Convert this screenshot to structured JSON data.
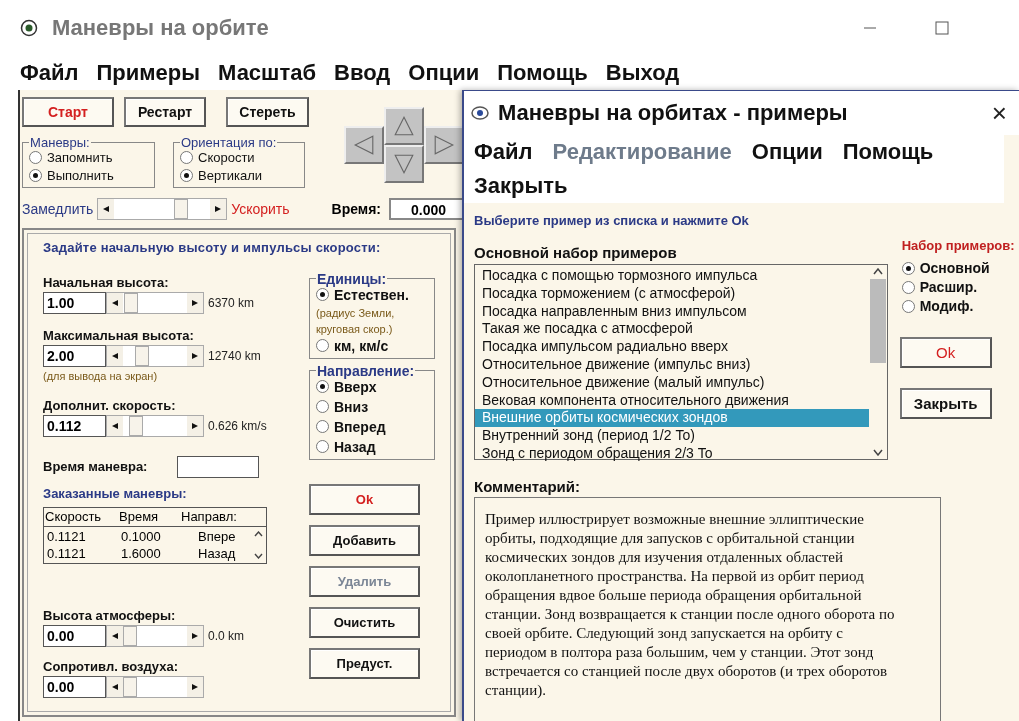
{
  "main_window": {
    "title": "Маневры на орбите",
    "menu": [
      "Файл",
      "Примеры",
      "Масштаб",
      "Ввод",
      "Опции",
      "Помощь",
      "Выход"
    ],
    "buttons": [
      {
        "label": "Старт",
        "kind": "accent"
      },
      {
        "label": "Рестарт",
        "kind": "normal"
      },
      {
        "label": "Стереть",
        "kind": "normal"
      }
    ],
    "groups": [
      {
        "title": "Маневры:",
        "options": [
          {
            "label": "Запомнить",
            "selected": false
          },
          {
            "label": "Выполнить",
            "selected": true
          }
        ]
      },
      {
        "title": "Ориентация по:",
        "options": [
          {
            "label": "Скорости",
            "selected": false
          },
          {
            "label": "Вертикали",
            "selected": true
          }
        ]
      }
    ],
    "speed": {
      "slower": "Замедлить",
      "faster": "Ускорить"
    },
    "time": {
      "label": "Время:",
      "value": "0.000"
    },
    "panel": {
      "heading": "Задайте начальную высоту и импульсы скорости:",
      "inputs": [
        {
          "label": "Начальная высота:",
          "value": "1.00",
          "reading": "6370 km"
        },
        {
          "label": "Максимальная высота:",
          "value": "2.00",
          "reading": "12740 km",
          "note": "(для вывода на экран)"
        },
        {
          "label": "Дополнит. скорость:",
          "value": "0.112",
          "reading": "0.626 km/s"
        }
      ],
      "maneuver_time": {
        "label": "Время маневра:"
      },
      "units": {
        "title": "Единицы:",
        "options": [
          {
            "label": "Естествен.",
            "selected": true,
            "note": "(радиус Земли, круговая скор.)"
          },
          {
            "label": "км,  км/с",
            "selected": false
          }
        ]
      },
      "direction": {
        "title": "Направление:",
        "options": [
          {
            "label": "Вверх",
            "selected": true
          },
          {
            "label": "Вниз",
            "selected": false
          },
          {
            "label": "Вперед",
            "selected": false
          },
          {
            "label": "Назад",
            "selected": false
          }
        ]
      },
      "ordered": {
        "title": "Заказанные маневры:",
        "columns": [
          "Скорость",
          "Время",
          "Направл:"
        ],
        "rows": [
          [
            "0.1121",
            "0.1000",
            "Впере"
          ],
          [
            "0.1121",
            "1.6000",
            "Назад"
          ]
        ]
      },
      "atmosphere": [
        {
          "label": "Высота атмосферы:",
          "value": "0.00",
          "reading": "0.0 km"
        },
        {
          "label": "Сопротивл. воздуха:",
          "value": "0.00"
        }
      ],
      "buttons": [
        {
          "label": "Ok",
          "kind": "accent",
          "disabled": false
        },
        {
          "label": "Добавить",
          "kind": "normal",
          "disabled": false
        },
        {
          "label": "Удалить",
          "kind": "normal",
          "disabled": true
        },
        {
          "label": "Очистить",
          "kind": "normal",
          "disabled": false
        },
        {
          "label": "Предуст.",
          "kind": "normal",
          "disabled": false
        }
      ]
    }
  },
  "dialog": {
    "title": "Маневры на орбитах - примеры",
    "close": "×",
    "menu": [
      {
        "label": "Файл",
        "disabled": false
      },
      {
        "label": "Редактирование",
        "disabled": true
      },
      {
        "label": "Опции",
        "disabled": false
      },
      {
        "label": "Помощь",
        "disabled": false
      },
      {
        "label": "Закрыть",
        "disabled": false
      }
    ],
    "instruction": "Выберите пример из списка и нажмите Ok",
    "list_title": "Основной набор примеров",
    "examples": [
      {
        "label": "Посадка с помощью тормозного импульса",
        "selected": false
      },
      {
        "label": "Посадка торможением (с атмосферой)",
        "selected": false
      },
      {
        "label": "Посадка направленным вниз импульсом",
        "selected": false
      },
      {
        "label": "Такая же посадка с атмосферой",
        "selected": false
      },
      {
        "label": "Посадка импульсом радиально вверх",
        "selected": false
      },
      {
        "label": "Относительное движение (импульс вниз)",
        "selected": false
      },
      {
        "label": "Относительное движение (малый импульс)",
        "selected": false
      },
      {
        "label": "Вековая компонента относительного движения",
        "selected": false
      },
      {
        "label": "Внешние орбиты космических зондов",
        "selected": true
      },
      {
        "label": "Внутренний зонд (период 1/2 To)",
        "selected": false
      },
      {
        "label": "Зонд с периодом обращения 2/3 To",
        "selected": false
      }
    ],
    "set_title": "Набор примеров:",
    "sets": [
      {
        "label": "Основной",
        "selected": true
      },
      {
        "label": "Расшир.",
        "selected": false
      },
      {
        "label": "Модиф.",
        "selected": false
      }
    ],
    "buttons": [
      {
        "label": "Ok",
        "kind": "accent"
      },
      {
        "label": "Закрыть",
        "kind": "normal"
      }
    ],
    "comment_title": "Комментарий:",
    "comment": "Пример иллюстрирует возможные внешние эллиптические орбиты, подходящие для запусков с орбитальной станции космических зондов для изучения отдаленных областей околопланетного пространства. На первой из орбит период обращения вдвое больше периода обращения орбитальной станции. Зонд возвращается к станции после одного оборота по своей орбите. Следующий зонд запускается на орбиту с периодом в полтора раза большим, чем у станции. Этот зонд встречается со станцией после двух оборотов (и трех оборотов станции)."
  }
}
